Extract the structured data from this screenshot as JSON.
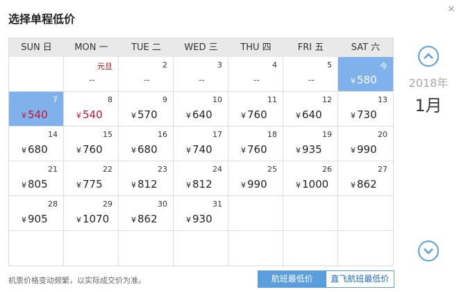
{
  "dialog": {
    "title": "选择单程低价",
    "close_glyph": "×"
  },
  "calendar": {
    "weekdays": [
      "SUN 日",
      "MON 一",
      "TUE 二",
      "WED 三",
      "THU 四",
      "FRI 五",
      "SAT 六"
    ],
    "currency": "¥",
    "days": [
      {
        "num": "",
        "price": "",
        "dash": ""
      },
      {
        "num": "元旦",
        "price": "",
        "dash": "--",
        "holiday": true
      },
      {
        "num": "2",
        "price": "",
        "dash": "--"
      },
      {
        "num": "3",
        "price": "",
        "dash": "--"
      },
      {
        "num": "4",
        "price": "",
        "dash": "--"
      },
      {
        "num": "5",
        "price": "",
        "dash": "--"
      },
      {
        "num": "今",
        "price": "580",
        "dash": "",
        "selected": true
      },
      {
        "num": "7",
        "price": "540",
        "dash": "",
        "red": true,
        "selected": true
      },
      {
        "num": "8",
        "price": "540",
        "dash": "",
        "red": true
      },
      {
        "num": "9",
        "price": "570",
        "dash": ""
      },
      {
        "num": "10",
        "price": "640",
        "dash": ""
      },
      {
        "num": "11",
        "price": "760",
        "dash": ""
      },
      {
        "num": "12",
        "price": "640",
        "dash": ""
      },
      {
        "num": "13",
        "price": "730",
        "dash": ""
      },
      {
        "num": "14",
        "price": "680",
        "dash": ""
      },
      {
        "num": "15",
        "price": "760",
        "dash": ""
      },
      {
        "num": "16",
        "price": "680",
        "dash": ""
      },
      {
        "num": "17",
        "price": "740",
        "dash": ""
      },
      {
        "num": "18",
        "price": "760",
        "dash": ""
      },
      {
        "num": "19",
        "price": "935",
        "dash": ""
      },
      {
        "num": "20",
        "price": "990",
        "dash": ""
      },
      {
        "num": "21",
        "price": "805",
        "dash": ""
      },
      {
        "num": "22",
        "price": "775",
        "dash": ""
      },
      {
        "num": "23",
        "price": "812",
        "dash": ""
      },
      {
        "num": "24",
        "price": "812",
        "dash": ""
      },
      {
        "num": "25",
        "price": "990",
        "dash": ""
      },
      {
        "num": "26",
        "price": "1000",
        "dash": ""
      },
      {
        "num": "27",
        "price": "862",
        "dash": ""
      },
      {
        "num": "28",
        "price": "905",
        "dash": ""
      },
      {
        "num": "29",
        "price": "1070",
        "dash": ""
      },
      {
        "num": "30",
        "price": "862",
        "dash": ""
      },
      {
        "num": "31",
        "price": "930",
        "dash": ""
      },
      {
        "num": "",
        "price": "",
        "dash": ""
      },
      {
        "num": "",
        "price": "",
        "dash": ""
      },
      {
        "num": "",
        "price": "",
        "dash": ""
      },
      {
        "num": "",
        "price": "",
        "dash": ""
      },
      {
        "num": "",
        "price": "",
        "dash": ""
      },
      {
        "num": "",
        "price": "",
        "dash": ""
      },
      {
        "num": "",
        "price": "",
        "dash": ""
      },
      {
        "num": "",
        "price": "",
        "dash": ""
      },
      {
        "num": "",
        "price": "",
        "dash": ""
      },
      {
        "num": "",
        "price": "",
        "dash": ""
      }
    ]
  },
  "nav": {
    "prev_icon": "chevron-up-icon",
    "next_icon": "chevron-down-icon",
    "year": "2018年",
    "month": "1月"
  },
  "footer": {
    "note": "机票价格变动频繁，以实际成交价为准。",
    "toggle_all": "航班最低价",
    "toggle_direct": "直飞航班最低价"
  },
  "colors": {
    "accent": "#5a9ede",
    "selected": "#7fb2ec",
    "low_price": "#c8102e"
  }
}
